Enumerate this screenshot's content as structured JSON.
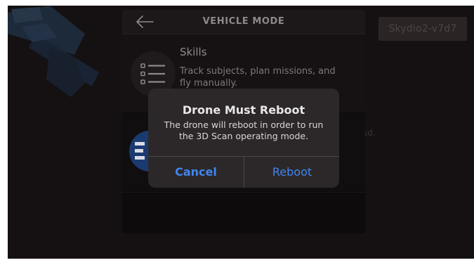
{
  "header": {
    "title": "VEHICLE MODE",
    "back_icon": "arrow-left-icon"
  },
  "device_badge": "Skydio2-v7d7",
  "modes": [
    {
      "name": "Skills",
      "description": "Track subjects, plan missions, and fly manually.",
      "icon": "list-icon"
    },
    {
      "name": "",
      "description": "",
      "icon": "3d-scan-icon",
      "icon_color": "#1f5ed6"
    }
  ],
  "side_text": "sd.",
  "dialog": {
    "title": "Drone Must Reboot",
    "message": "The drone will reboot in order to run the 3D Scan operating mode.",
    "cancel_label": "Cancel",
    "confirm_label": "Reboot",
    "accent_color": "#3f86f0"
  }
}
